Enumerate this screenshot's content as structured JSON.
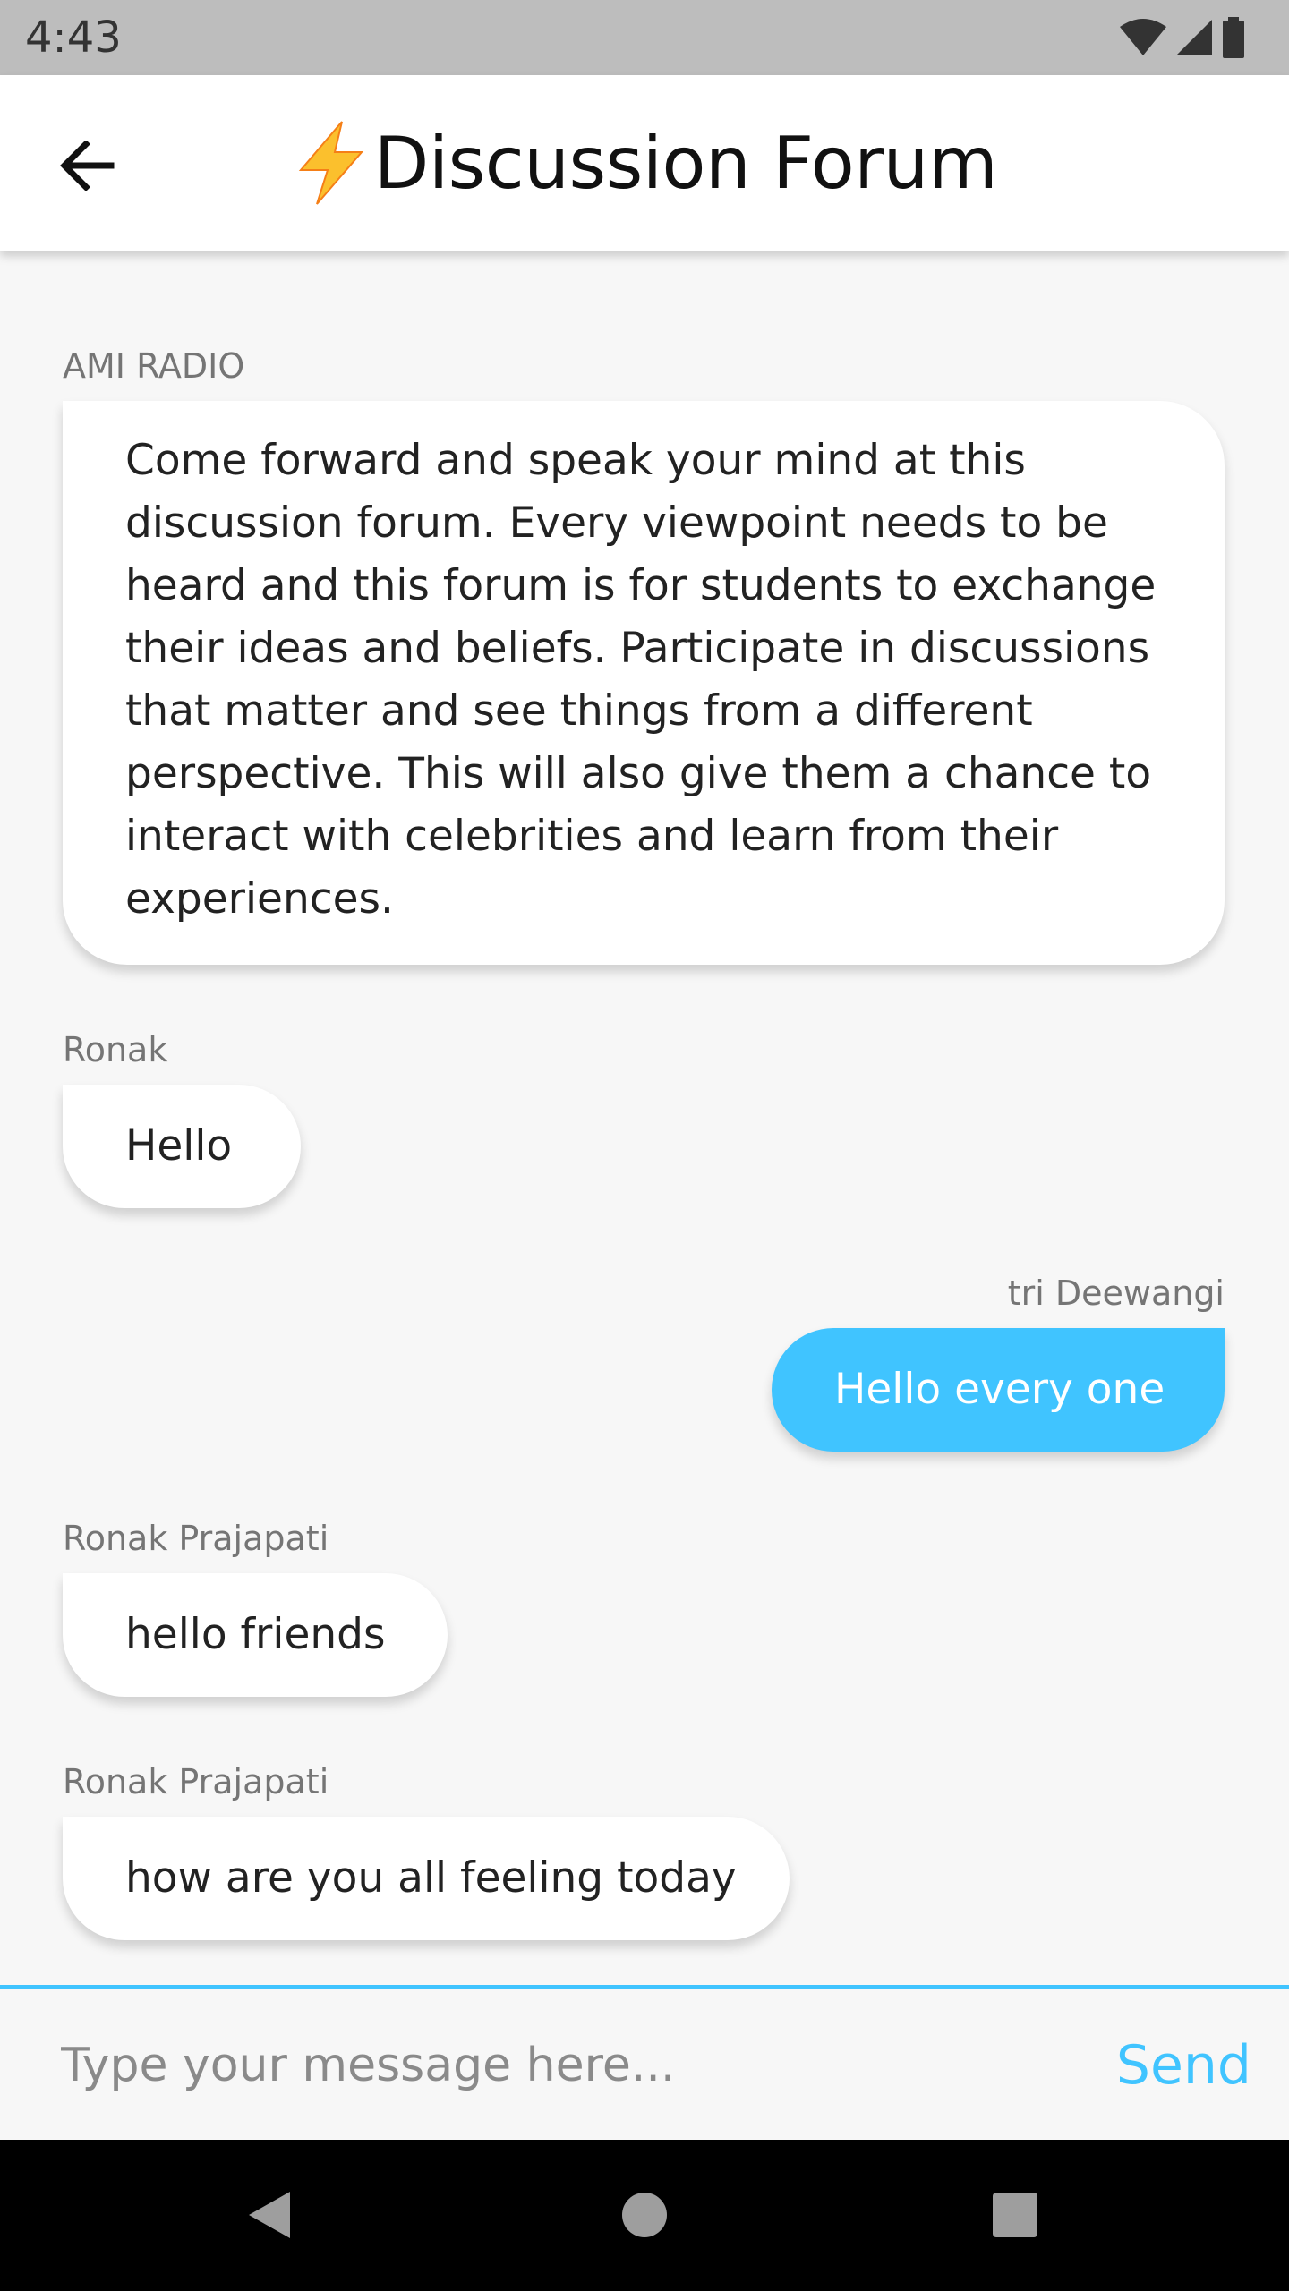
{
  "status_bar": {
    "time": "4:43",
    "icons": [
      "wifi-icon",
      "signal-icon",
      "battery-icon"
    ]
  },
  "app_bar": {
    "title": "Discussion Forum",
    "title_icon": "lightning-bolt-icon",
    "back_icon": "arrow-back-icon"
  },
  "colors": {
    "accent": "#40c4ff",
    "bolt": "#fbc02d",
    "background": "#f7f7f7",
    "status_bar": "#bdbdbd"
  },
  "messages": [
    {
      "sender": "AMI RADIO",
      "text": "Come forward and speak your mind at this discussion forum. Every viewpoint needs to be heard and this forum is for students to exchange their ideas and beliefs. Participate in discussions that matter and see things from a different perspective. This will also give them a chance to interact with celebrities and learn from their experiences.",
      "direction": "incoming"
    },
    {
      "sender": "Ronak",
      "text": "Hello",
      "direction": "incoming"
    },
    {
      "sender": "tri Deewangi",
      "text": "Hello every one",
      "direction": "outgoing"
    },
    {
      "sender": "Ronak Prajapati",
      "text": "hello friends",
      "direction": "incoming"
    },
    {
      "sender": "Ronak Prajapati",
      "text": "how are you all feeling today",
      "direction": "incoming"
    }
  ],
  "composer": {
    "placeholder": "Type your message here...",
    "value": "",
    "send_label": "Send"
  },
  "nav_bar": {
    "buttons": [
      "back-triangle-icon",
      "home-circle-icon",
      "recents-square-icon"
    ]
  }
}
